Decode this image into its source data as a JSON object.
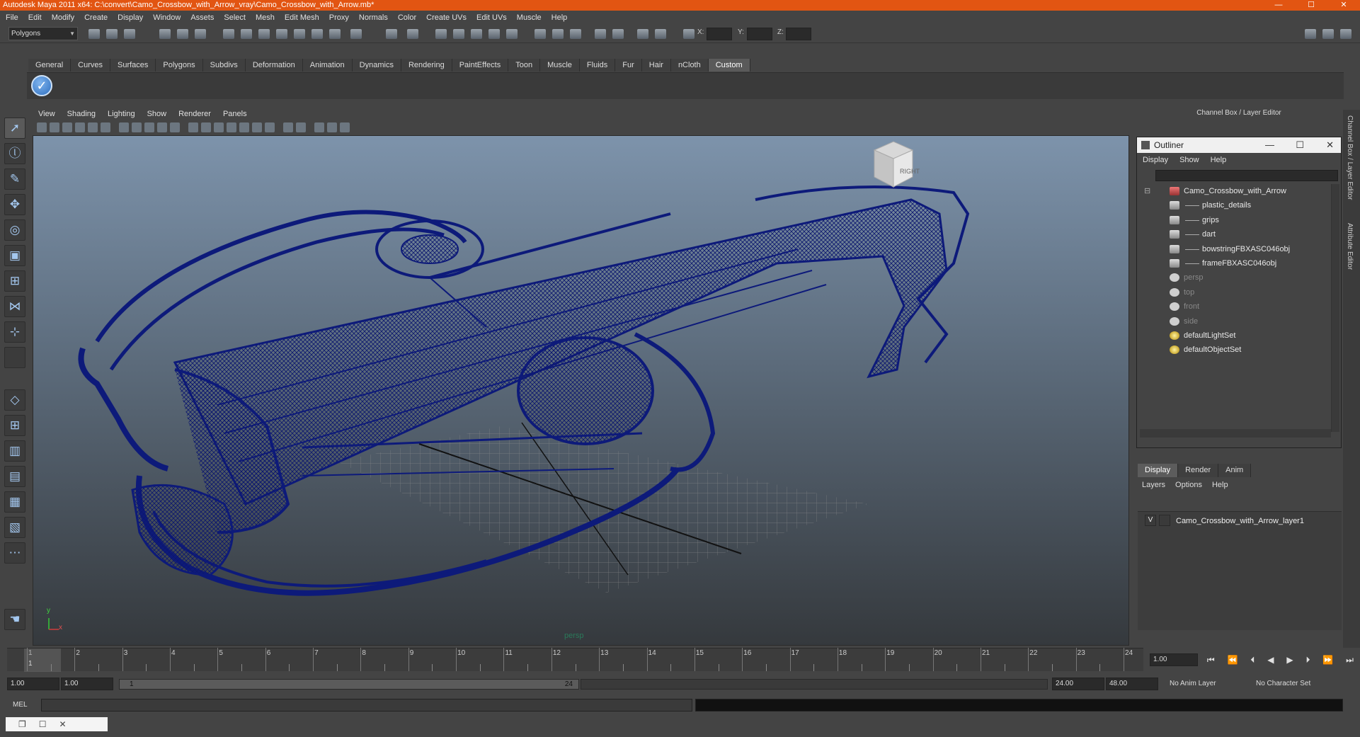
{
  "window": {
    "title": "Autodesk Maya 2011 x64: C:\\convert\\Camo_Crossbow_with_Arrow_vray\\Camo_Crossbow_with_Arrow.mb*",
    "minimize": "—",
    "maximize": "☐",
    "close": "✕"
  },
  "menubar": [
    "File",
    "Edit",
    "Modify",
    "Create",
    "Display",
    "Window",
    "Assets",
    "Select",
    "Mesh",
    "Edit Mesh",
    "Proxy",
    "Normals",
    "Color",
    "Create UVs",
    "Edit UVs",
    "Muscle",
    "Help"
  ],
  "statusline": {
    "mode": "Polygons",
    "x_label": "X:",
    "y_label": "Y:",
    "z_label": "Z:"
  },
  "shelf": {
    "tabs": [
      "General",
      "Curves",
      "Surfaces",
      "Polygons",
      "Subdivs",
      "Deformation",
      "Animation",
      "Dynamics",
      "Rendering",
      "PaintEffects",
      "Toon",
      "Muscle",
      "Fluids",
      "Fur",
      "Hair",
      "nCloth",
      "Custom"
    ],
    "active": "Custom"
  },
  "viewport": {
    "menu": [
      "View",
      "Shading",
      "Lighting",
      "Show",
      "Renderer",
      "Panels"
    ],
    "camera": "persp",
    "viewcube_face": "RIGHT",
    "axis_x": "x",
    "axis_y": "y"
  },
  "channel_box": {
    "title": "Channel Box / Layer Editor"
  },
  "outliner": {
    "title": "Outliner",
    "menu": [
      "Display",
      "Show",
      "Help"
    ],
    "items": [
      {
        "label": "Camo_Crossbow_with_Arrow",
        "kind": "root",
        "indent": 0
      },
      {
        "label": "plastic_details",
        "kind": "mesh",
        "indent": 1
      },
      {
        "label": "grips",
        "kind": "mesh",
        "indent": 1
      },
      {
        "label": "dart",
        "kind": "mesh",
        "indent": 1
      },
      {
        "label": "bowstringFBXASC046obj",
        "kind": "mesh",
        "indent": 1
      },
      {
        "label": "frameFBXASC046obj",
        "kind": "mesh",
        "indent": 1
      },
      {
        "label": "persp",
        "kind": "camera",
        "indent": 0
      },
      {
        "label": "top",
        "kind": "camera",
        "indent": 0
      },
      {
        "label": "front",
        "kind": "camera",
        "indent": 0
      },
      {
        "label": "side",
        "kind": "camera",
        "indent": 0
      },
      {
        "label": "defaultLightSet",
        "kind": "set",
        "indent": 0
      },
      {
        "label": "defaultObjectSet",
        "kind": "set",
        "indent": 0
      }
    ]
  },
  "layer_editor": {
    "tabs": [
      "Display",
      "Render",
      "Anim"
    ],
    "active": "Display",
    "menu": [
      "Layers",
      "Options",
      "Help"
    ],
    "layer": {
      "visible": "V",
      "name": "Camo_Crossbow_with_Arrow_layer1"
    }
  },
  "side_tabs": [
    "Channel Box / Layer Editor",
    "Attribute Editor"
  ],
  "timeline": {
    "ticks": [
      "1",
      "2",
      "3",
      "4",
      "5",
      "6",
      "7",
      "8",
      "9",
      "10",
      "11",
      "12",
      "13",
      "14",
      "15",
      "16",
      "17",
      "18",
      "19",
      "20",
      "21",
      "22",
      "23",
      "24"
    ],
    "current_marker": "1",
    "current_time": "1.00"
  },
  "range": {
    "start": "1.00",
    "playback_start": "1.00",
    "slider_low": "1",
    "slider_high": "24",
    "playback_end": "24.00",
    "end": "48.00",
    "anim_layer": "No Anim Layer",
    "character_set": "No Character Set"
  },
  "command_line": {
    "label": "MEL"
  },
  "colors": {
    "titlebar": "#e25512",
    "wireframe": "#0d1a7a",
    "background": "#444444"
  }
}
